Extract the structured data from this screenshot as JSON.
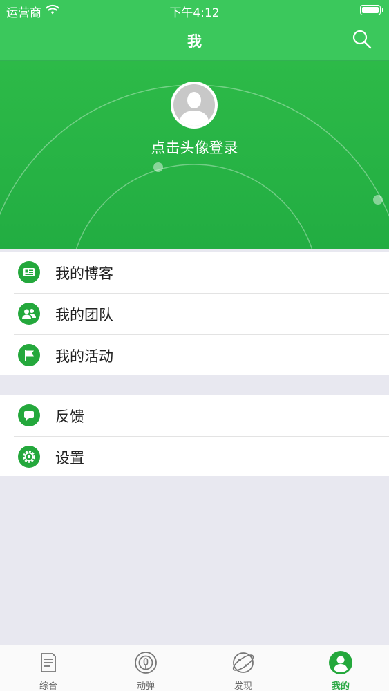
{
  "status_bar": {
    "carrier": "运营商",
    "time": "下午4:12",
    "wifi_icon": "wifi-icon",
    "battery_icon": "battery-icon"
  },
  "nav": {
    "title": "我",
    "search_icon": "search-icon"
  },
  "profile": {
    "login_prompt": "点击头像登录",
    "avatar_icon": "default-avatar-icon"
  },
  "menu_groups": [
    {
      "items": [
        {
          "label": "我的博客",
          "icon": "blog-icon"
        },
        {
          "label": "我的团队",
          "icon": "team-icon"
        },
        {
          "label": "我的活动",
          "icon": "flag-icon"
        }
      ]
    },
    {
      "items": [
        {
          "label": "反馈",
          "icon": "feedback-icon"
        },
        {
          "label": "设置",
          "icon": "settings-icon"
        }
      ]
    }
  ],
  "tabs": [
    {
      "label": "综合",
      "icon": "news-icon",
      "active": false
    },
    {
      "label": "动弹",
      "icon": "tweet-icon",
      "active": false
    },
    {
      "label": "发现",
      "icon": "discover-icon",
      "active": false
    },
    {
      "label": "我的",
      "icon": "user-icon",
      "active": true
    }
  ],
  "colors": {
    "primary": "#3bc85c",
    "hero": "#22ad42",
    "icon_green": "#24a83c",
    "background": "#e8e8f0"
  }
}
